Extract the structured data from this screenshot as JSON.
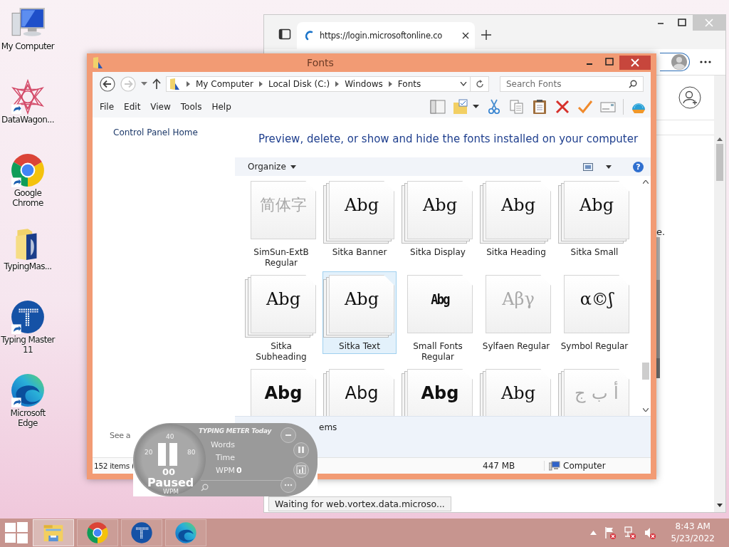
{
  "desktop_icons": [
    {
      "label": "My Computer",
      "kind": "computer",
      "shortcut": false
    },
    {
      "label": "DataWagon...",
      "kind": "star",
      "shortcut": true
    },
    {
      "label": "Google Chrome",
      "kind": "chrome",
      "shortcut": true
    },
    {
      "label": "TypingMas...",
      "kind": "folder",
      "shortcut": false
    },
    {
      "label": "Typing Master 11",
      "kind": "typing",
      "shortcut": true
    },
    {
      "label": "Microsoft Edge",
      "kind": "edge",
      "shortcut": true
    }
  ],
  "browser": {
    "tab": {
      "title": "https://login.microsoftonline.co",
      "selected": true
    },
    "page_text": "e.",
    "status_text": "Waiting for web.vortex.data.microso..."
  },
  "explorer": {
    "title": "Fonts",
    "breadcrumb": [
      "My Computer",
      "Local Disk (C:)",
      "Windows",
      "Fonts"
    ],
    "search": {
      "placeholder": "Search Fonts"
    },
    "menu": [
      "File",
      "Edit",
      "View",
      "Tools",
      "Help"
    ],
    "sidebar": {
      "links": [
        "Control Panel Home"
      ],
      "see_also": "See a"
    },
    "heading": "Preview, delete, or show and hide the fonts installed on your computer",
    "organize": "Organize",
    "help_glyph": "?",
    "fonts": [
      {
        "name": "SimSun-ExtB Regular",
        "preview": "简体字",
        "kind": "cjk",
        "stacked": false,
        "hidden": true,
        "selected": false
      },
      {
        "name": "Sitka Banner",
        "preview": "Abg",
        "kind": "serif",
        "stacked": true,
        "hidden": false,
        "selected": false
      },
      {
        "name": "Sitka Display",
        "preview": "Abg",
        "kind": "serif",
        "stacked": true,
        "hidden": false,
        "selected": false
      },
      {
        "name": "Sitka Heading",
        "preview": "Abg",
        "kind": "serif",
        "stacked": true,
        "hidden": false,
        "selected": false
      },
      {
        "name": "Sitka Small",
        "preview": "Abg",
        "kind": "serif",
        "stacked": true,
        "hidden": false,
        "selected": false
      },
      {
        "name": "Sitka Subheading",
        "preview": "Abg",
        "kind": "serif",
        "stacked": true,
        "hidden": false,
        "selected": false
      },
      {
        "name": "Sitka Text",
        "preview": "Abg",
        "kind": "serif",
        "stacked": true,
        "hidden": false,
        "selected": true
      },
      {
        "name": "Small Fonts Regular",
        "preview": "Abg",
        "kind": "pixel",
        "stacked": false,
        "hidden": false,
        "selected": false
      },
      {
        "name": "Sylfaen Regular",
        "preview": "Αβγ",
        "kind": "serif",
        "stacked": false,
        "hidden": true,
        "selected": false
      },
      {
        "name": "Symbol Regular",
        "preview": "α©ʃ",
        "kind": "serif",
        "stacked": false,
        "hidden": false,
        "selected": false
      },
      {
        "preview": "Abg",
        "kind": "bold",
        "stacked": false,
        "hidden": false,
        "selected": false
      },
      {
        "preview": "Abg",
        "kind": "sans",
        "stacked": true,
        "hidden": false,
        "selected": false
      },
      {
        "preview": "Abg",
        "kind": "bold",
        "stacked": true,
        "hidden": false,
        "selected": false
      },
      {
        "preview": "Abg",
        "kind": "serif",
        "stacked": true,
        "hidden": false,
        "selected": false
      },
      {
        "preview": "أ ب ج",
        "kind": "serif",
        "stacked": true,
        "hidden": true,
        "selected": false
      }
    ],
    "details": "ems",
    "status_bar": {
      "count": "152 items (",
      "size": "447 MB",
      "location": "Computer"
    }
  },
  "typing_meter": {
    "title": "TYPING METER Today",
    "labels": [
      "Words",
      "Time",
      "WPM"
    ],
    "wpm_value": "0",
    "dial_ticks": [
      "20",
      "40",
      "80"
    ],
    "dial_value": "00",
    "state": "Paused",
    "dial_unit": "WPM"
  },
  "taskbar": {
    "apps": [
      {
        "kind": "explorer",
        "selected": true
      },
      {
        "kind": "chrome",
        "selected": false
      },
      {
        "kind": "typing",
        "selected": false
      },
      {
        "kind": "edge",
        "selected": false
      }
    ],
    "clock": {
      "time": "8:43 AM",
      "date": "5/23/2022"
    }
  }
}
